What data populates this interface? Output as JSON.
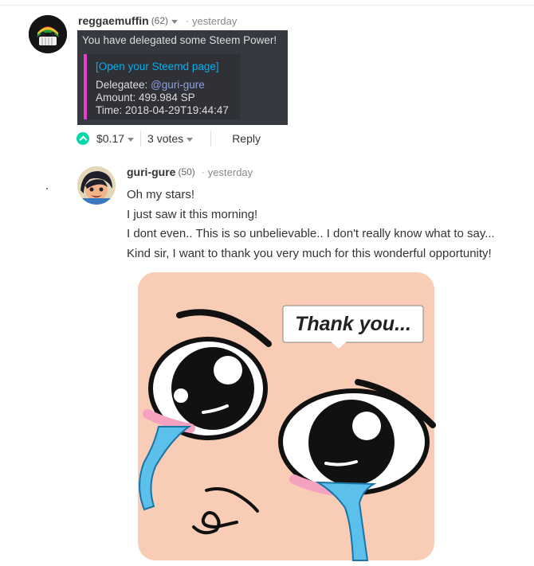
{
  "comment1": {
    "author": "reggaemuffin",
    "reputation": "(62)",
    "separator": "·",
    "timestamp": "yesterday",
    "embed": {
      "title": "You have delegated some Steem Power!",
      "link": "[Open your Steemd page]",
      "delegatee_label": "Delegatee: ",
      "delegatee": "@guri-gure",
      "amount": "Amount: 499.984 SP",
      "time": "Time: 2018-04-29T19:44:47"
    },
    "payout": "$0.17",
    "votes": "3 votes",
    "reply": "Reply"
  },
  "comment2": {
    "author": "guri-gure",
    "reputation": "(50)",
    "separator": "·",
    "timestamp": "yesterday",
    "lines": [
      "Oh my stars!",
      "I just saw it this morning!",
      "I dont even.. This is so unbelievable.. I don't really know what to say...",
      "Kind sir, I want to thank you very much for this wonderful opportunity!"
    ],
    "image_caption": "Thank you..."
  },
  "colors": {
    "upvote": "#06d6a9",
    "embed_bg": "#36393f",
    "embed_accent": "#e83ccf",
    "link": "#00b0f4",
    "mention": "#8ea0e1",
    "image_skin": "#f9cdb5",
    "tears": "#5bc0eb"
  },
  "icons": [
    "reggae-muffin-avatar",
    "guri-gure-avatar",
    "upvote-icon",
    "chevron-down-icon"
  ]
}
